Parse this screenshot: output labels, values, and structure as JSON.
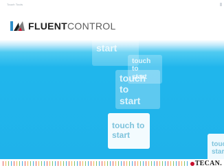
{
  "window": {
    "title": "Touch Tools"
  },
  "logo": {
    "bold": "FLUENT",
    "light": "CONTROL"
  },
  "tiles": [
    {
      "text": "start"
    },
    {
      "text": "touch to\nstart"
    },
    {
      "text": "touch to\nstart"
    },
    {
      "text": "touch to\nstart"
    },
    {
      "text": "touch\nstart"
    }
  ],
  "brand": {
    "name": "TECAN."
  },
  "colors": {
    "touch_area": "#1fb2ea",
    "tile_text": "#ffffff",
    "brand_red": "#c8102e"
  }
}
